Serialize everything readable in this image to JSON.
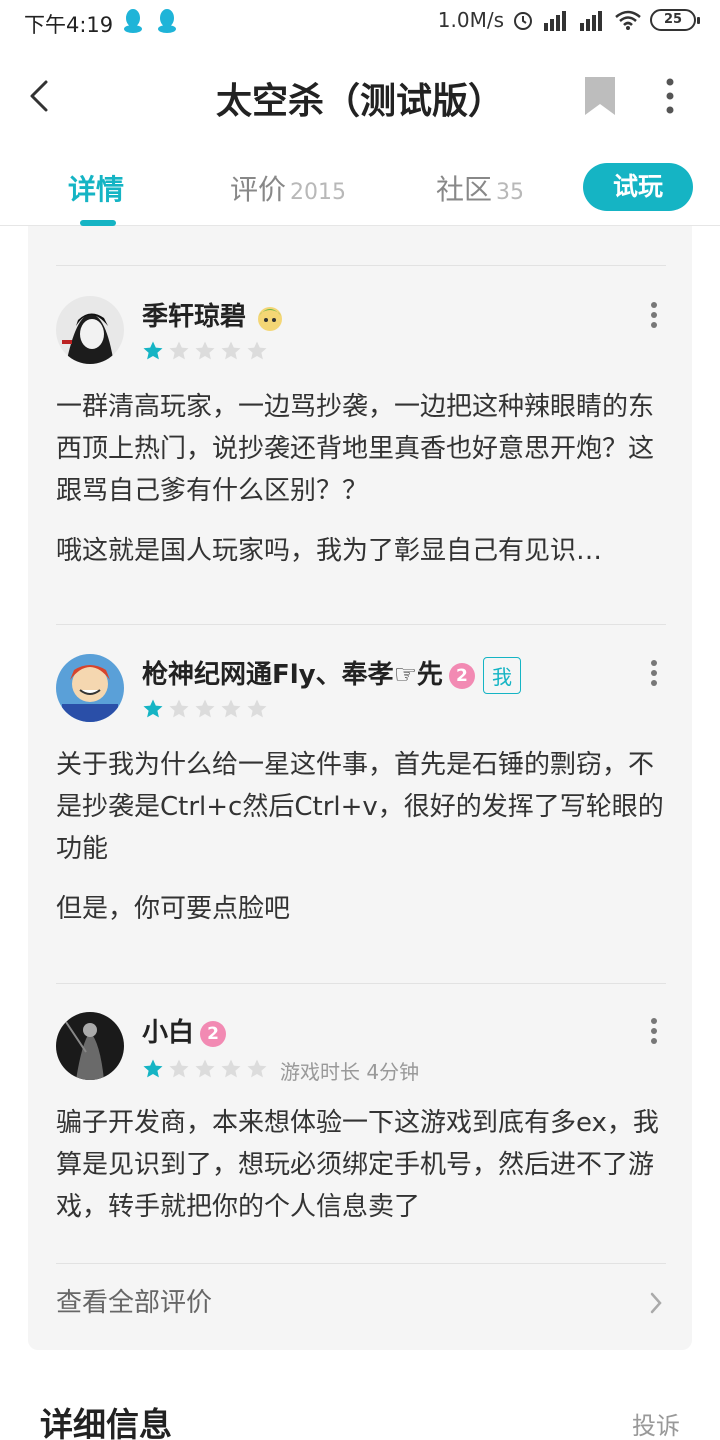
{
  "status_bar": {
    "time": "下午4:19",
    "network_speed": "1.0M/s",
    "battery": "25"
  },
  "header": {
    "title": "太空杀（测试版）"
  },
  "tabs": [
    {
      "label": "详情",
      "count": ""
    },
    {
      "label": "评价",
      "count": "2015"
    },
    {
      "label": "社区",
      "count": "35"
    }
  ],
  "try_button": "试玩",
  "reviews": [
    {
      "name": "季轩琼碧",
      "rating": 1,
      "meta": "",
      "paragraphs": [
        "一群清高玩家，一边骂抄袭，一边把这种辣眼睛的东西顶上热门，说抄袭还背地里真香也好意思开炮？这跟骂自己爹有什么区别？？",
        "哦这就是国人玩家吗，我为了彰显自己有见识…"
      ]
    },
    {
      "name": "枪神纪网通Fly、奉孝☞先",
      "badge": "2",
      "me_tag": "我",
      "rating": 1,
      "meta": "",
      "paragraphs": [
        "关于我为什么给一星这件事，首先是石锤的剽窃，不是抄袭是Ctrl+c然后Ctrl+v，很好的发挥了写轮眼的功能",
        "但是，你可要点脸吧"
      ]
    },
    {
      "name": "小白",
      "badge": "2",
      "rating": 1,
      "meta": "游戏时长 4分钟",
      "paragraphs": [
        "骗子开发商，本来想体验一下这游戏到底有多ex，我算是见识到了，想玩必须绑定手机号，然后进不了游戏，转手就把你的个人信息卖了"
      ]
    }
  ],
  "view_all": "查看全部评价",
  "details": {
    "title": "详细信息",
    "report": "投诉"
  },
  "colors": {
    "accent": "#15b4c4",
    "star_filled": "#15b4c4",
    "star_empty": "#dcdcdc",
    "badge_pink": "#f28ab3"
  }
}
